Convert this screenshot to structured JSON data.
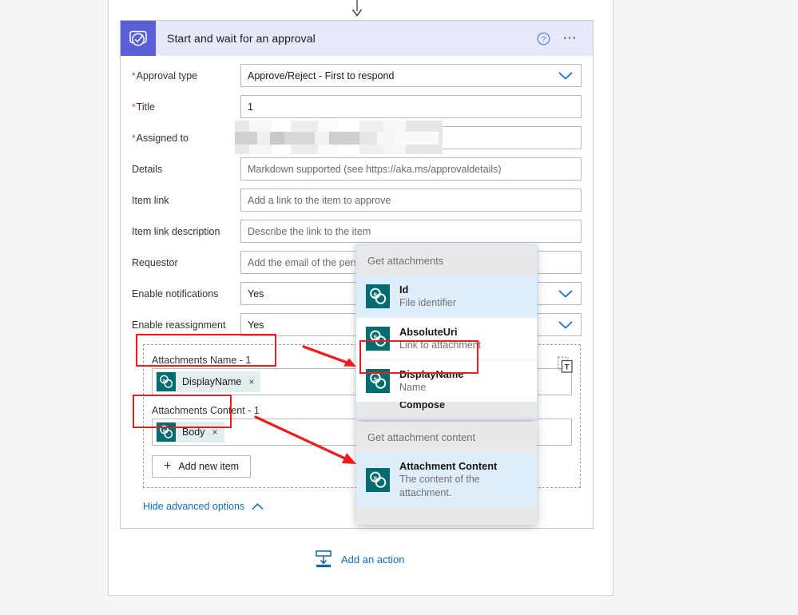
{
  "card": {
    "title": "Start and wait for an approval",
    "icon": "approval-icon",
    "help_icon": "help-circle-icon",
    "more_icon": "ellipsis-icon",
    "header_bg": "#e8e8fb",
    "icon_bg": "#5b5fd6"
  },
  "fields": [
    {
      "label": "Approval type",
      "required": true,
      "value": "Approve/Reject - First to respond",
      "placeholder": "",
      "is_placeholder": false,
      "dropdown": true,
      "blurred": false
    },
    {
      "label": "Title",
      "required": true,
      "value": "1",
      "placeholder": "",
      "is_placeholder": false,
      "dropdown": false,
      "blurred": false
    },
    {
      "label": "Assigned to",
      "required": true,
      "value": "",
      "placeholder": "",
      "is_placeholder": false,
      "dropdown": false,
      "blurred": true
    },
    {
      "label": "Details",
      "required": false,
      "value": "Markdown supported (see https://aka.ms/approvaldetails)",
      "placeholder": "Markdown supported (see https://aka.ms/approvaldetails)",
      "is_placeholder": true,
      "dropdown": false,
      "blurred": false
    },
    {
      "label": "Item link",
      "required": false,
      "value": "Add a link to the item to approve",
      "placeholder": "Add a link to the item to approve",
      "is_placeholder": true,
      "dropdown": false,
      "blurred": false
    },
    {
      "label": "Item link description",
      "required": false,
      "value": "Describe the link to the item",
      "placeholder": "Describe the link to the item",
      "is_placeholder": true,
      "dropdown": false,
      "blurred": false
    },
    {
      "label": "Requestor",
      "required": false,
      "value": "Add the email of the person requesting this approval",
      "placeholder": "Add the email of the person requesting this approval",
      "is_placeholder": true,
      "dropdown": false,
      "blurred": false
    },
    {
      "label": "Enable notifications",
      "required": false,
      "value": "Yes",
      "placeholder": "",
      "is_placeholder": false,
      "dropdown": true,
      "blurred": false
    },
    {
      "label": "Enable reassignment",
      "required": false,
      "value": "Yes",
      "placeholder": "",
      "is_placeholder": false,
      "dropdown": true,
      "blurred": false
    }
  ],
  "attachments": {
    "name_label": "Attachments Name - 1",
    "name_token": {
      "text": "DisplayName",
      "icon": "sharepoint-icon",
      "remove": "×"
    },
    "content_label": "Attachments Content - 1",
    "content_token": {
      "text": "Body",
      "icon": "sharepoint-icon",
      "remove": "×"
    },
    "add_new_label": "Add new item",
    "add_new_plus": "+",
    "copy_icon": "copy-text-icon"
  },
  "advanced": {
    "hide_label": "Hide advanced options",
    "caret_icon": "chevron-up-icon"
  },
  "add_action": {
    "label": "Add an action",
    "icon": "insert-action-icon"
  },
  "popups": [
    {
      "id": "get-attachments",
      "header": "Get attachments",
      "items": [
        {
          "name": "Id",
          "desc": "File identifier",
          "icon": "sharepoint-icon",
          "selected": true
        },
        {
          "name": "AbsoluteUri",
          "desc": "Link to attachment",
          "icon": "sharepoint-icon",
          "selected": false
        },
        {
          "name": "DisplayName",
          "desc": "Name",
          "icon": "sharepoint-icon",
          "selected": false
        }
      ],
      "footer_peek": "Compose"
    },
    {
      "id": "get-attachment-content",
      "header": "Get attachment content",
      "items": [
        {
          "name": "Attachment Content",
          "desc": "The content of the attachment.",
          "icon": "sharepoint-icon",
          "selected": true
        }
      ],
      "footer_peek": ""
    }
  ],
  "annotations": {
    "highlight_color": "#ee1c1c",
    "boxes": [
      "attachments-name-token",
      "displayname-popup-item",
      "attachments-content-token"
    ],
    "arrows": [
      "name-token-to-displayname",
      "content-token-to-attachment-content"
    ]
  },
  "colors": {
    "accent_blue": "#0f6cbd",
    "sharepoint_teal": "#036c70",
    "selected_row": "#dfeefc",
    "popup_header": "#e9e9e9"
  }
}
